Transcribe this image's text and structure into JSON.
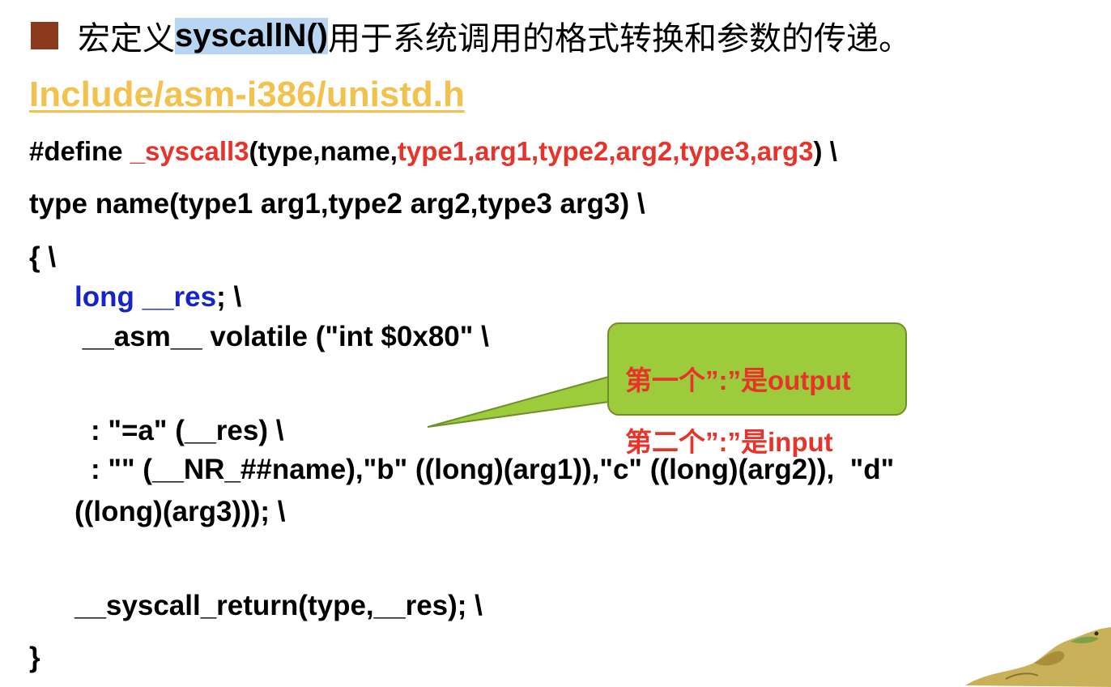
{
  "heading": {
    "prefix": "宏定义",
    "code": "syscallN()",
    "suffix": "用于系统调用的格式转换和参数的传递。"
  },
  "file_link": "Include/asm-i386/unistd.h",
  "code": {
    "define_prefix": "#define ",
    "define_macro": "_syscall3",
    "define_open": "(type,name,",
    "define_params": "type1,arg1,type2,arg2,type3,arg3",
    "define_close": ") \\",
    "signature": "type name(type1 arg1,type2 arg2,type3 arg3) \\",
    "open_brace": "{ \\",
    "long_res": "long __res",
    "long_res_tail": "; \\",
    "asm_line": " __asm__ volatile (\"int $0x80\" \\",
    "output_line": ": \"=a\" (__res) \\",
    "input_line": ": \"\" (__NR_##name),\"b\" ((long)(arg1)),\"c\" ((long)(arg2)),  \"d\"",
    "input_cont": "((long)(arg3))); \\",
    "return_line": "__syscall_return(type,__res); \\",
    "close_brace": "}"
  },
  "callout": {
    "line1": "第一个”:”是output",
    "line2": "第二个”:”是input",
    "fill": "#9ccb3c",
    "text_color": "#e8332a"
  },
  "colors": {
    "bullet": "#8b3a1e",
    "highlight": "#b8d6f2",
    "link": "#f2c14e",
    "keyword_red": "#e8332a",
    "keyword_blue": "#1524c8"
  }
}
